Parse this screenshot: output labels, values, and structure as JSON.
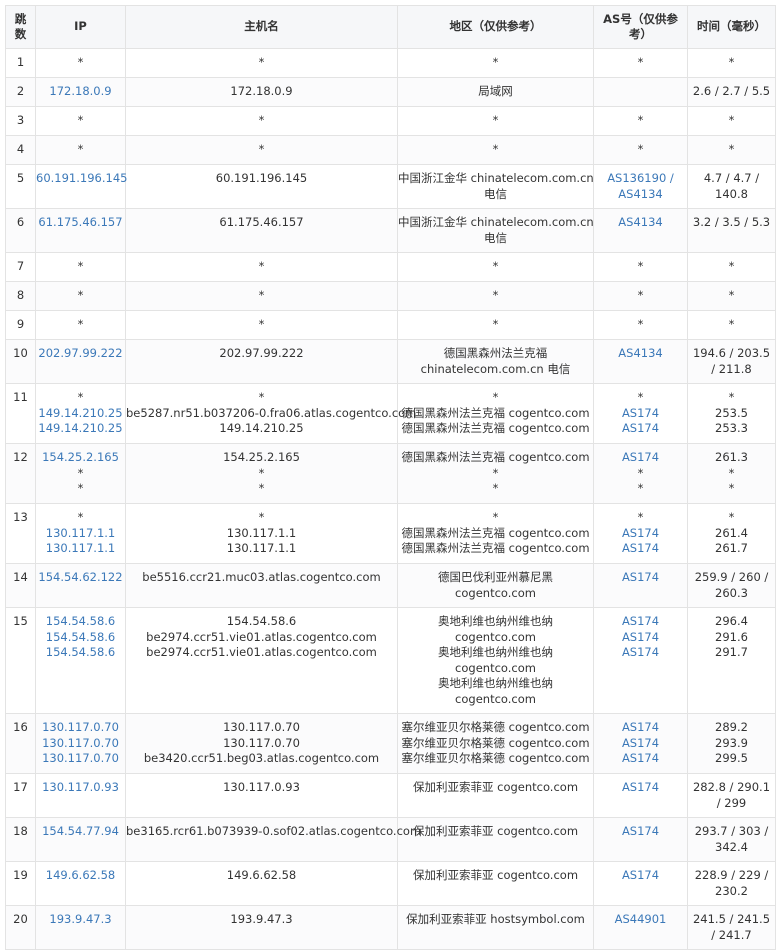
{
  "headers": {
    "hop": "跳数",
    "ip": "IP",
    "host": "主机名",
    "region": "地区（仅供参考）",
    "as": "AS号（仅供参考）",
    "time": "时间（毫秒）"
  },
  "rows": [
    {
      "hop": "1",
      "ip": [
        "*"
      ],
      "host": [
        "*"
      ],
      "region": [
        "*"
      ],
      "as": [
        "*"
      ],
      "time": [
        "*"
      ]
    },
    {
      "hop": "2",
      "ip": [
        "172.18.0.9"
      ],
      "host": [
        "172.18.0.9"
      ],
      "region": [
        "局域网"
      ],
      "as": [],
      "time": [
        "2.6 / 2.7 / 5.5"
      ]
    },
    {
      "hop": "3",
      "ip": [
        "*"
      ],
      "host": [
        "*"
      ],
      "region": [
        "*"
      ],
      "as": [
        "*"
      ],
      "time": [
        "*"
      ]
    },
    {
      "hop": "4",
      "ip": [
        "*"
      ],
      "host": [
        "*"
      ],
      "region": [
        "*"
      ],
      "as": [
        "*"
      ],
      "time": [
        "*"
      ]
    },
    {
      "hop": "5",
      "ip": [
        "60.191.196.145"
      ],
      "host": [
        "60.191.196.145"
      ],
      "region": [
        "中国浙江金华 chinatelecom.com.cn",
        "电信"
      ],
      "as": [
        "AS136190 /",
        "AS4134"
      ],
      "time": [
        "4.7 / 4.7 /",
        "140.8"
      ]
    },
    {
      "hop": "6",
      "ip": [
        "61.175.46.157"
      ],
      "host": [
        "61.175.46.157"
      ],
      "region": [
        "中国浙江金华 chinatelecom.com.cn",
        "电信"
      ],
      "as": [
        "AS4134"
      ],
      "time": [
        "3.2 / 3.5 / 5.3"
      ]
    },
    {
      "hop": "7",
      "ip": [
        "*"
      ],
      "host": [
        "*"
      ],
      "region": [
        "*"
      ],
      "as": [
        "*"
      ],
      "time": [
        "*"
      ]
    },
    {
      "hop": "8",
      "ip": [
        "*"
      ],
      "host": [
        "*"
      ],
      "region": [
        "*"
      ],
      "as": [
        "*"
      ],
      "time": [
        "*"
      ]
    },
    {
      "hop": "9",
      "ip": [
        "*"
      ],
      "host": [
        "*"
      ],
      "region": [
        "*"
      ],
      "as": [
        "*"
      ],
      "time": [
        "*"
      ]
    },
    {
      "hop": "10",
      "ip": [
        "202.97.99.222"
      ],
      "host": [
        "202.97.99.222"
      ],
      "region": [
        "德国黑森州法兰克福",
        "chinatelecom.com.cn 电信"
      ],
      "as": [
        "AS4134"
      ],
      "time": [
        "194.6 / 203.5",
        "/ 211.8"
      ]
    },
    {
      "hop": "11",
      "ip": [
        "*",
        "149.14.210.25",
        "149.14.210.25"
      ],
      "host": [
        "*",
        "be5287.nr51.b037206-0.fra06.atlas.cogentco.com",
        "149.14.210.25"
      ],
      "region": [
        "*",
        "德国黑森州法兰克福 cogentco.com",
        "德国黑森州法兰克福 cogentco.com"
      ],
      "as": [
        "*",
        "AS174",
        "AS174"
      ],
      "time": [
        "*",
        "253.5",
        "253.3"
      ]
    },
    {
      "hop": "12",
      "ip": [
        "154.25.2.165",
        "*",
        "*"
      ],
      "host": [
        "154.25.2.165",
        "*",
        "*"
      ],
      "region": [
        "德国黑森州法兰克福 cogentco.com",
        "*",
        "*"
      ],
      "as": [
        "AS174",
        "*",
        "*"
      ],
      "time": [
        "261.3",
        "*",
        "*"
      ]
    },
    {
      "hop": "13",
      "ip": [
        "*",
        "130.117.1.1",
        "130.117.1.1"
      ],
      "host": [
        "*",
        "130.117.1.1",
        "130.117.1.1"
      ],
      "region": [
        "*",
        "德国黑森州法兰克福 cogentco.com",
        "德国黑森州法兰克福 cogentco.com"
      ],
      "as": [
        "*",
        "AS174",
        "AS174"
      ],
      "time": [
        "*",
        "261.4",
        "261.7"
      ]
    },
    {
      "hop": "14",
      "ip": [
        "154.54.62.122"
      ],
      "host": [
        "be5516.ccr21.muc03.atlas.cogentco.com"
      ],
      "region": [
        "德国巴伐利亚州慕尼黑",
        "cogentco.com"
      ],
      "as": [
        "AS174"
      ],
      "time": [
        "259.9 / 260 /",
        "260.3"
      ]
    },
    {
      "hop": "15",
      "ip": [
        "154.54.58.6",
        "154.54.58.6",
        "154.54.58.6"
      ],
      "host": [
        "154.54.58.6",
        "be2974.ccr51.vie01.atlas.cogentco.com",
        "be2974.ccr51.vie01.atlas.cogentco.com"
      ],
      "region": [
        "奥地利维也纳州维也纳",
        "cogentco.com",
        "奥地利维也纳州维也纳",
        "cogentco.com",
        "奥地利维也纳州维也纳",
        "cogentco.com"
      ],
      "as": [
        "AS174",
        "AS174",
        "AS174"
      ],
      "time": [
        "296.4",
        "291.6",
        "291.7"
      ]
    },
    {
      "hop": "16",
      "ip": [
        "130.117.0.70",
        "130.117.0.70",
        "130.117.0.70"
      ],
      "host": [
        "130.117.0.70",
        "130.117.0.70",
        "be3420.ccr51.beg03.atlas.cogentco.com"
      ],
      "region": [
        "塞尔维亚贝尔格莱德 cogentco.com",
        "塞尔维亚贝尔格莱德 cogentco.com",
        "塞尔维亚贝尔格莱德 cogentco.com"
      ],
      "as": [
        "AS174",
        "AS174",
        "AS174"
      ],
      "time": [
        "289.2",
        "293.9",
        "299.5"
      ]
    },
    {
      "hop": "17",
      "ip": [
        "130.117.0.93"
      ],
      "host": [
        "130.117.0.93"
      ],
      "region": [
        "保加利亚索菲亚 cogentco.com"
      ],
      "as": [
        "AS174"
      ],
      "time": [
        "282.8 / 290.1",
        "/ 299"
      ]
    },
    {
      "hop": "18",
      "ip": [
        "154.54.77.94"
      ],
      "host": [
        "be3165.rcr61.b073939-0.sof02.atlas.cogentco.com"
      ],
      "region": [
        "保加利亚索菲亚 cogentco.com"
      ],
      "as": [
        "AS174"
      ],
      "time": [
        "293.7 / 303 /",
        "342.4"
      ]
    },
    {
      "hop": "19",
      "ip": [
        "149.6.62.58"
      ],
      "host": [
        "149.6.62.58"
      ],
      "region": [
        "保加利亚索菲亚 cogentco.com"
      ],
      "as": [
        "AS174"
      ],
      "time": [
        "228.9 / 229 /",
        "230.2"
      ]
    },
    {
      "hop": "20",
      "ip": [
        "193.9.47.3"
      ],
      "host": [
        "193.9.47.3"
      ],
      "region": [
        "保加利亚索菲亚 hostsymbol.com"
      ],
      "as": [
        "AS44901"
      ],
      "time": [
        "241.5 / 241.5",
        "/ 241.7"
      ]
    }
  ]
}
